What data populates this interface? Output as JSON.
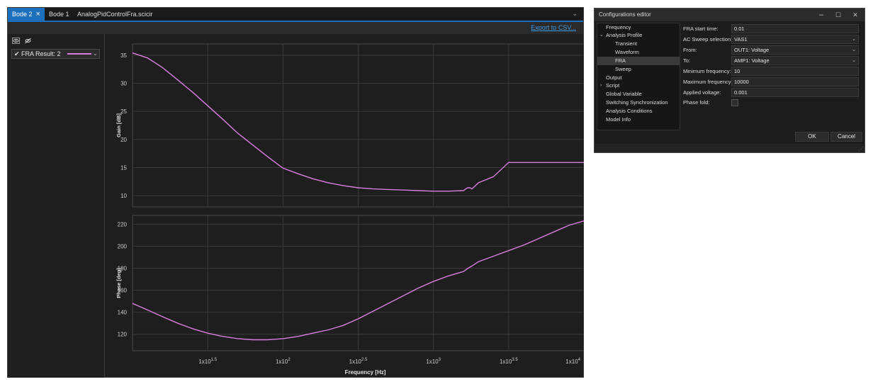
{
  "bode_window": {
    "tabs": [
      {
        "label": "Bode 2",
        "active": true,
        "close_icon": "close-icon",
        "close_glyph": "×"
      },
      {
        "label": "Bode 1",
        "active": false
      },
      {
        "label": "AnalogPidControlFra.scicir",
        "active": false
      }
    ],
    "dropdown_glyph": "⌄",
    "export_label": "Export to CSV...",
    "visibility_icons": [
      "eye-icon",
      "eye-off-icon"
    ],
    "legend": {
      "check": "✔",
      "label": "FRA Result: 2",
      "arrow": "⌄",
      "color": "#d97ee0"
    },
    "colors": {
      "accent": "#1c6fbd",
      "series": "#d97ee0",
      "link": "#3d9be9",
      "plot_background": "#1e1e1e",
      "grid": "#3a3a3a"
    }
  },
  "chart_data": [
    {
      "type": "line",
      "title": "",
      "ylabel": "Gain [dB]",
      "xlabel": "",
      "xscale": "log",
      "xlim": [
        10,
        10000
      ],
      "ylim": [
        8,
        37
      ],
      "yticks": [
        10,
        15,
        20,
        25,
        30,
        35
      ],
      "grid": true,
      "series": [
        {
          "name": "FRA Result: 2",
          "color": "#d97ee0",
          "x": [
            10,
            12.6,
            15.8,
            20,
            25.1,
            31.6,
            39.8,
            50.1,
            63.1,
            79.4,
            100,
            126,
            158,
            200,
            251,
            316,
            398,
            501,
            631,
            794,
            1000,
            1259,
            1585,
            1660,
            1700,
            1750,
            1800,
            1995,
            2512,
            3162,
            3981,
            5012,
            6310,
            7943,
            10000
          ],
          "y": [
            35.4,
            34.5,
            32.8,
            30.6,
            28.4,
            26.0,
            23.6,
            21.1,
            19.0,
            16.9,
            14.9,
            13.9,
            13.0,
            12.3,
            11.8,
            11.4,
            11.2,
            11.1,
            11.0,
            10.9,
            10.8,
            10.8,
            10.9,
            11.3,
            11.4,
            11.4,
            11.2,
            12.3,
            13.4,
            15.9,
            15.9,
            15.9,
            15.9,
            15.9,
            15.9
          ]
        }
      ]
    },
    {
      "type": "line",
      "title": "",
      "ylabel": "Phase [deg]",
      "xlabel": "Frequency [Hz]",
      "xscale": "log",
      "xlim": [
        10,
        10000
      ],
      "ylim": [
        105,
        228
      ],
      "yticks": [
        120,
        140,
        160,
        180,
        200,
        220
      ],
      "xtick_labels": [
        {
          "base": "1x10",
          "exp": "1.5"
        },
        {
          "base": "1x10",
          "exp": "2"
        },
        {
          "base": "1x10",
          "exp": "2.5"
        },
        {
          "base": "1x10",
          "exp": "3"
        },
        {
          "base": "1x10",
          "exp": "3.5"
        },
        {
          "base": "1x10",
          "exp": "4"
        }
      ],
      "grid": true,
      "series": [
        {
          "name": "FRA Result: 2",
          "color": "#d97ee0",
          "x": [
            10,
            12.6,
            15.8,
            20,
            25.1,
            31.6,
            39.8,
            50.1,
            63.1,
            79.4,
            100,
            126,
            158,
            200,
            251,
            316,
            398,
            501,
            631,
            794,
            1000,
            1259,
            1585,
            1700,
            1800,
            1995,
            2512,
            3162,
            3981,
            5012,
            6310,
            7943,
            10000
          ],
          "y": [
            148,
            142,
            136,
            130,
            125,
            121,
            118,
            116,
            115,
            115,
            116,
            118,
            121,
            124,
            128,
            134,
            141,
            148,
            155,
            162,
            168,
            173,
            177,
            180,
            182,
            186,
            191,
            196,
            201,
            207,
            213,
            219,
            223
          ]
        }
      ]
    }
  ],
  "config_window": {
    "title": "Configurations editor",
    "window_buttons": {
      "minimize": "–",
      "maximize": "☐",
      "close": "✕"
    },
    "tree": [
      {
        "label": "Frequency",
        "level": 0,
        "arrow": ""
      },
      {
        "label": "Analysis Profile",
        "level": 0,
        "arrow": "⌄"
      },
      {
        "label": "Transient",
        "level": 1
      },
      {
        "label": "Waveform",
        "level": 1
      },
      {
        "label": "FRA",
        "level": 1,
        "selected": true
      },
      {
        "label": "Sweep",
        "level": 1
      },
      {
        "label": "Output",
        "level": 0
      },
      {
        "label": "Script",
        "level": 0,
        "arrow": "›"
      },
      {
        "label": "Global Variable",
        "level": 0
      },
      {
        "label": "Switching Synchronization",
        "level": 0
      },
      {
        "label": "Analysis Conditions",
        "level": 0
      },
      {
        "label": "Model Info",
        "level": 0
      }
    ],
    "fields": [
      {
        "label": "FRA start time:",
        "value": "0.01",
        "dropdown": false
      },
      {
        "label": "AC Sweep selection:",
        "value": "VAS1",
        "dropdown": true
      },
      {
        "label": "From:",
        "value": "OUT1: Voltage",
        "dropdown": true
      },
      {
        "label": "To:",
        "value": "AMP1: Voltage",
        "dropdown": true
      },
      {
        "label": "Minimum frequency:",
        "value": "10",
        "dropdown": false
      },
      {
        "label": "Maximum frequency:",
        "value": "10000",
        "dropdown": false
      },
      {
        "label": "Applied voltage:",
        "value": "0.001",
        "dropdown": false
      }
    ],
    "phase_fold_label": "Phase fold:",
    "phase_fold_checked": false,
    "chevron_glyph": "⌄",
    "ok_label": "OK",
    "cancel_label": "Cancel",
    "resize_glyph": "⋰"
  }
}
